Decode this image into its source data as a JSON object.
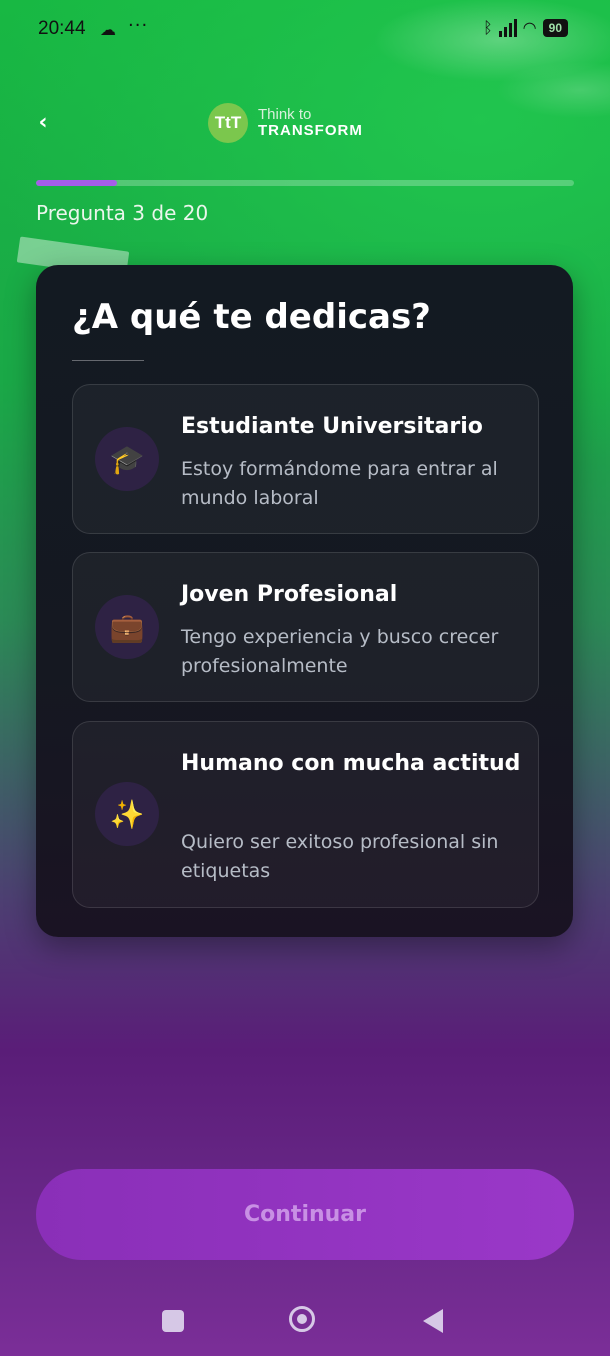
{
  "status_bar": {
    "time": "20:44",
    "dots": "···",
    "battery": "90"
  },
  "header": {
    "logo_mark": "TtT",
    "logo_line1": "Think to",
    "logo_line2": "TRANSFORM"
  },
  "progress": {
    "current": 3,
    "total": 20,
    "label": "Pregunta 3 de 20"
  },
  "question": {
    "title": "¿A qué te dedicas?",
    "options": [
      {
        "icon": "graduation-cap-icon",
        "glyph": "🎓",
        "title": "Estudiante Universitario",
        "description": "Estoy formándome para entrar al mundo laboral"
      },
      {
        "icon": "briefcase-icon",
        "glyph": "💼",
        "title": "Joven Profesional",
        "description": "Tengo experiencia y busco crecer profesionalmente"
      },
      {
        "icon": "sparkles-icon",
        "glyph": "✨",
        "title": "Humano con mucha actitud",
        "description": "Quiero ser exitoso profesional sin etiquetas"
      }
    ]
  },
  "actions": {
    "continue_label": "Continuar"
  },
  "colors": {
    "accent": "#a45ee8",
    "button": "#9a38c8",
    "card": "#151821"
  }
}
